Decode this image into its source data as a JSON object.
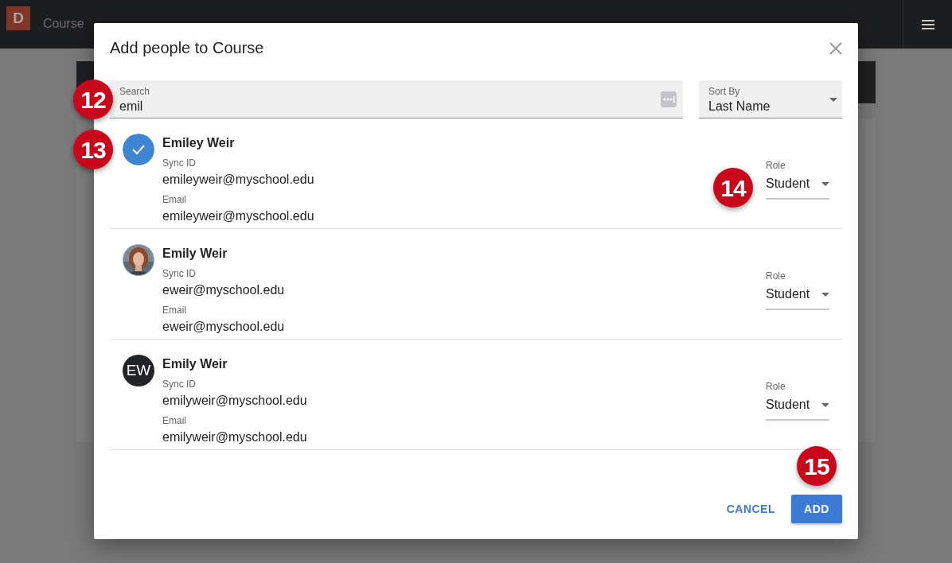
{
  "navbar": {
    "logo": "D",
    "breadcrumbs": [
      "Course"
    ]
  },
  "dialog": {
    "title": "Add people to Course",
    "search": {
      "label": "Search",
      "value": "emil"
    },
    "sort": {
      "label": "Sort By",
      "value": "Last Name"
    },
    "people": [
      {
        "name": "Emiley Weir",
        "selected": true,
        "sync_label": "Sync ID",
        "sync_id": "emileyweir@myschool.edu",
        "email_label": "Email",
        "email": "emileyweir@myschool.edu",
        "role_label": "Role",
        "role": "Student"
      },
      {
        "name": "Emily Weir",
        "selected": false,
        "sync_label": "Sync ID",
        "sync_id": "eweir@myschool.edu",
        "email_label": "Email",
        "email": "eweir@myschool.edu",
        "role_label": "Role",
        "role": "Student"
      },
      {
        "name": "Emily Weir",
        "selected": false,
        "avatar": {
          "kind": "initials",
          "text": "EW"
        },
        "sync_label": "Sync ID",
        "sync_id": "emilyweir@myschool.edu",
        "email_label": "Email",
        "email": "emilyweir@myschool.edu",
        "role_label": "Role",
        "role": "Student"
      }
    ],
    "buttons": [
      {
        "label": "CANCEL",
        "kind": "text"
      },
      {
        "label": "ADD",
        "kind": "primary"
      }
    ]
  },
  "callouts": [
    {
      "number": "12"
    },
    {
      "number": "13"
    },
    {
      "number": "14"
    },
    {
      "number": "15"
    }
  ]
}
